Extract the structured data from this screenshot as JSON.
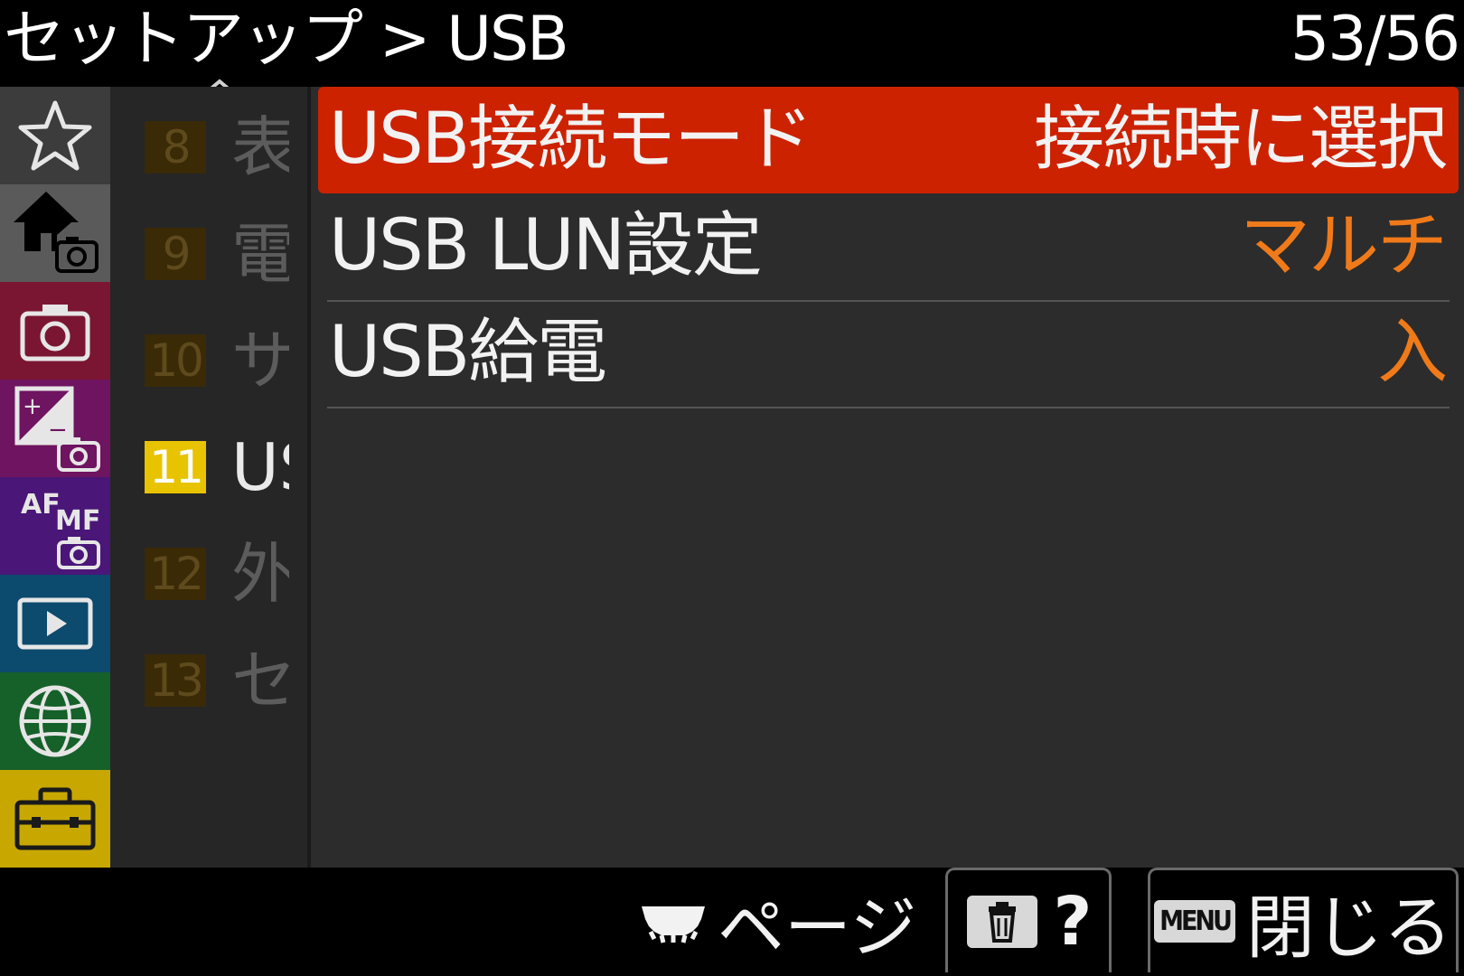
{
  "header": {
    "title": "セットアップ > USB",
    "page_counter": "53/56"
  },
  "tabs": [
    {
      "name": "favorites",
      "icon": "star-icon",
      "color": "#3c3c3c"
    },
    {
      "name": "main",
      "icon": "home-camera-icon",
      "color": "#5a5a5a"
    },
    {
      "name": "shooting",
      "icon": "camera-icon",
      "color": "#7a1632"
    },
    {
      "name": "exposure-color",
      "icon": "exposure-camera-icon",
      "color": "#6e1460"
    },
    {
      "name": "focus",
      "icon": "af-mf-camera-icon",
      "color": "#4a1678"
    },
    {
      "name": "playback",
      "icon": "play-icon",
      "color": "#0c4a6e"
    },
    {
      "name": "network",
      "icon": "globe-icon",
      "color": "#16602a"
    },
    {
      "name": "setup",
      "icon": "toolbox-icon",
      "color": "#c8a800"
    }
  ],
  "subnav": {
    "items": [
      {
        "num": "8",
        "label": "表",
        "active": false
      },
      {
        "num": "9",
        "label": "電",
        "active": false
      },
      {
        "num": "10",
        "label": "サ",
        "active": false
      },
      {
        "num": "11",
        "label": "US",
        "active": true
      },
      {
        "num": "12",
        "label": "外",
        "active": false
      },
      {
        "num": "13",
        "label": "セ",
        "active": false
      }
    ]
  },
  "menu": {
    "items": [
      {
        "label": "USB接続モード",
        "value": "接続時に選択",
        "selected": true
      },
      {
        "label": "USB LUN設定",
        "value": "マルチ",
        "selected": false
      },
      {
        "label": "USB給電",
        "value": "入",
        "selected": false
      }
    ]
  },
  "footer": {
    "page_label": "ページ",
    "help_label": "?",
    "menu_key": "MENU",
    "close_label": "閉じる"
  },
  "colors": {
    "selected_row": "#cc2200",
    "value_accent": "#f07a1a",
    "active_tab_badge": "#e8c300"
  }
}
